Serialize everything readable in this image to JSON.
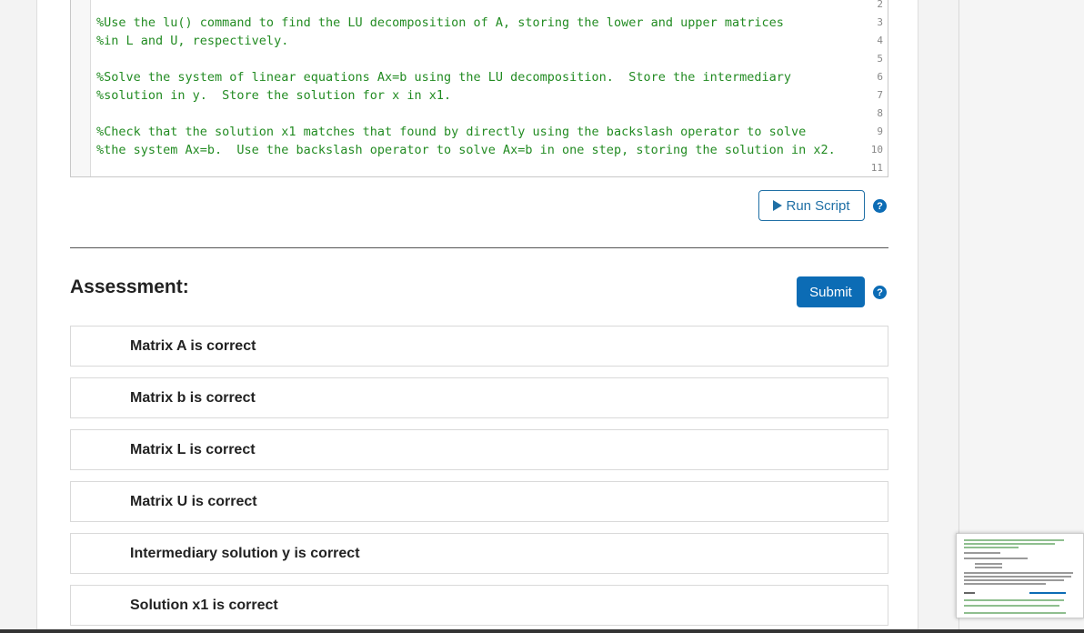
{
  "editor": {
    "lines": [
      {
        "num": "2",
        "text": ""
      },
      {
        "num": "3",
        "text": "%Use the lu() command to find the LU decomposition of A, storing the lower and upper matrices"
      },
      {
        "num": "4",
        "text": "%in L and U, respectively."
      },
      {
        "num": "5",
        "text": ""
      },
      {
        "num": "6",
        "text": "%Solve the system of linear equations Ax=b using the LU decomposition.  Store the intermediary"
      },
      {
        "num": "7",
        "text": "%solution in y.  Store the solution for x in x1."
      },
      {
        "num": "8",
        "text": ""
      },
      {
        "num": "9",
        "text": "%Check that the solution x1 matches that found by directly using the backslash operator to solve"
      },
      {
        "num": "10",
        "text": "%the system Ax=b.  Use the backslash operator to solve Ax=b in one step, storing the solution in x2."
      },
      {
        "num": "11",
        "text": ""
      }
    ]
  },
  "toolbar": {
    "run_label": "Run Script",
    "help_glyph": "?"
  },
  "assessment": {
    "title": "Assessment:",
    "submit_label": "Submit",
    "help_glyph": "?",
    "items": [
      {
        "label": "Matrix A is correct"
      },
      {
        "label": "Matrix b is correct"
      },
      {
        "label": "Matrix L is correct"
      },
      {
        "label": "Matrix U is correct"
      },
      {
        "label": "Intermediary solution y is correct"
      },
      {
        "label": "Solution x1 is correct"
      }
    ]
  },
  "colors": {
    "accent": "#0c6cb5",
    "comment_green": "#228b22"
  }
}
